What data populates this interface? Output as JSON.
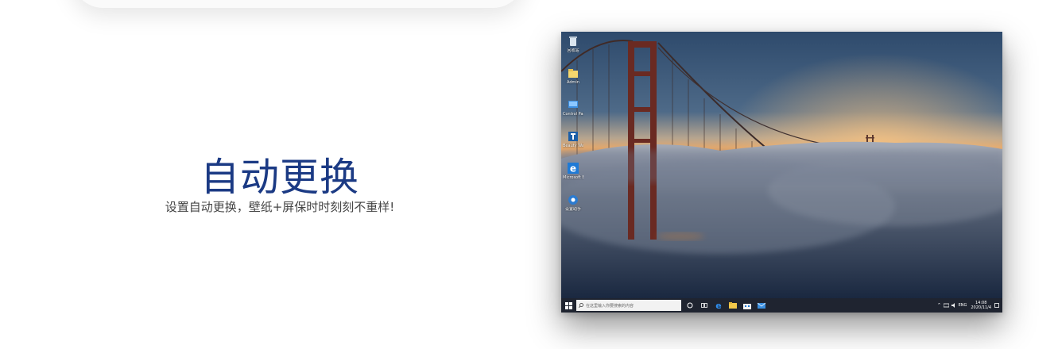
{
  "hero": {
    "title": "自动更换",
    "subtitle": "设置自动更换，壁纸+屏保时时刻刻不重样!"
  },
  "desktop": {
    "icons": [
      {
        "name": "recycle-bin-icon",
        "label": "回收站"
      },
      {
        "name": "folder-icon",
        "label": "Admin"
      },
      {
        "name": "control-panel-icon",
        "label": "Control Panel"
      },
      {
        "name": "beauty-app-icon",
        "label": "Beauty Wallpaper"
      },
      {
        "name": "edge-icon",
        "label": "Microsoft Edge"
      },
      {
        "name": "settings-app-icon",
        "label": "设置助手"
      }
    ]
  },
  "taskbar": {
    "search_placeholder": "在这里输入你要搜索的内容",
    "language": "ENG",
    "time": "14:08",
    "date": "2020/11/4"
  },
  "colors": {
    "title": "#1b3a84",
    "taskbar": "#1f2430",
    "edge_blue": "#1e7ad6"
  }
}
